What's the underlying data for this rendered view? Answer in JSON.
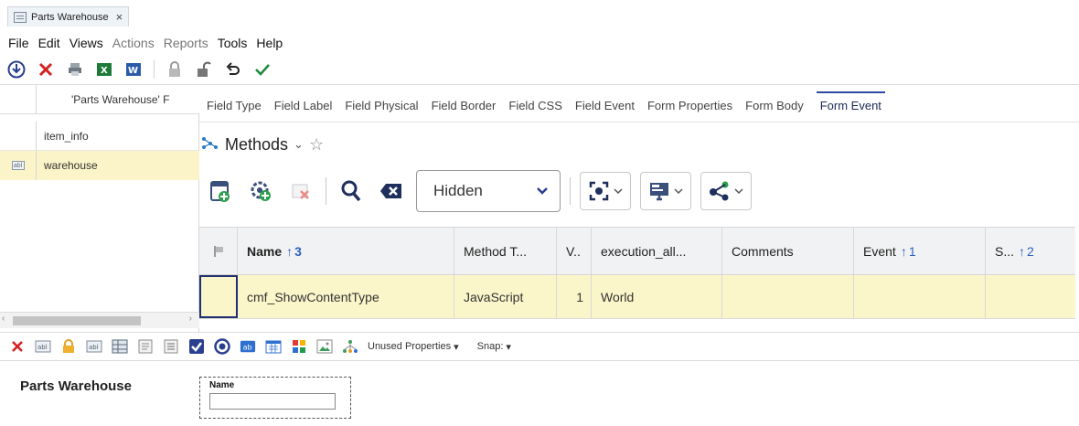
{
  "document_tab": {
    "title": "Parts Warehouse",
    "close": "×"
  },
  "menu": [
    "File",
    "Edit",
    "Views",
    "Actions",
    "Reports",
    "Tools",
    "Help"
  ],
  "menu_disabled": [
    "Actions",
    "Reports"
  ],
  "toolbar_icons": [
    "download-icon",
    "delete-icon",
    "print-icon",
    "excel-icon",
    "word-icon",
    "lock-icon",
    "unlock-icon",
    "undo-icon",
    "check-icon"
  ],
  "tree": {
    "header": "'Parts Warehouse' F",
    "items": [
      {
        "label": "item_info",
        "icon": ""
      },
      {
        "label": "warehouse",
        "icon": "abl"
      }
    ]
  },
  "property_tabs": [
    "Field Type",
    "Field Label",
    "Field Physical",
    "Field Border",
    "Field CSS",
    "Field Event",
    "Form Properties",
    "Form Body",
    "Form Event"
  ],
  "active_tab": "Form Event",
  "methods": {
    "title": "Methods",
    "caret": "⌄",
    "star": "☆"
  },
  "method_toolbar": {
    "select_value": "Hidden"
  },
  "grid": {
    "columns": [
      {
        "label": "Name",
        "sort_arrow": "↑",
        "sort_order": "3"
      },
      {
        "label": "Method T...",
        "sort_arrow": "",
        "sort_order": ""
      },
      {
        "label": "V..",
        "sort_arrow": "",
        "sort_order": ""
      },
      {
        "label": "execution_all...",
        "sort_arrow": "",
        "sort_order": ""
      },
      {
        "label": "Comments",
        "sort_arrow": "",
        "sort_order": ""
      },
      {
        "label": "Event",
        "sort_arrow": "↑",
        "sort_order": "1"
      },
      {
        "label": "S...",
        "sort_arrow": "↑",
        "sort_order": "2"
      }
    ],
    "rows": [
      {
        "name": "cmf_ShowContentType",
        "method_type": "JavaScript",
        "version": "1",
        "execution_allowed_to": "World",
        "comments": "",
        "event": "",
        "s": ""
      }
    ]
  },
  "bottom_toolbar": {
    "unused_properties": "Unused Properties",
    "snap": "Snap:",
    "dropdown_caret": "▾"
  },
  "designer": {
    "form_title": "Parts Warehouse",
    "field_label": "Name"
  },
  "colors": {
    "selection": "#fbf6c9",
    "accent": "#2f4aa0",
    "sort": "#2f5fc0"
  }
}
